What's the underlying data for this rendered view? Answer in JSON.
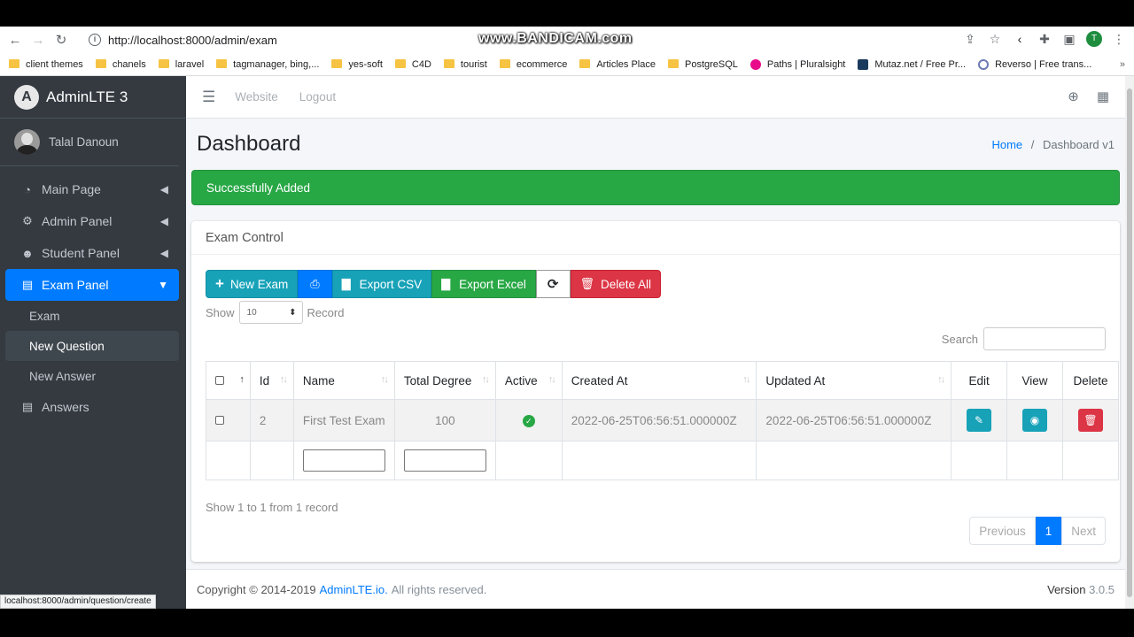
{
  "browser": {
    "url": "http://localhost:8000/admin/exam",
    "watermark": "www.BANDICAM.com",
    "profile_initial": "T",
    "status_url": "localhost:8000/admin/question/create",
    "bookmarks": [
      "client themes",
      "chanels",
      "laravel",
      "tagmanager, bing,...",
      "yes-soft",
      "C4D",
      "tourist",
      "ecommerce",
      "Articles Place",
      "PostgreSQL",
      "Paths | Pluralsight",
      "Mutaz.net / Free Pr...",
      "Reverso | Free trans..."
    ],
    "more": "»"
  },
  "sidebar": {
    "brand": "AdminLTE 3",
    "brand_logo": "A",
    "user": "Talal Danoun",
    "menu": [
      {
        "label": "Main Page",
        "icon": "tachometer-icon"
      },
      {
        "label": "Admin Panel",
        "icon": "users-cog-icon"
      },
      {
        "label": "Student Panel",
        "icon": "users-icon"
      },
      {
        "label": "Exam Panel",
        "icon": "file-icon"
      }
    ],
    "submenu": [
      "Exam",
      "New Question",
      "New Answer"
    ],
    "answers": "Answers"
  },
  "topnav": {
    "website": "Website",
    "logout": "Logout"
  },
  "page": {
    "title": "Dashboard",
    "breadcrumb_home": "Home",
    "breadcrumb_sep": "/",
    "breadcrumb_current": "Dashboard v1",
    "alert": "Successfully Added"
  },
  "card": {
    "title": "Exam Control",
    "buttons": {
      "new_exam": "New Exam",
      "export_csv": "Export CSV",
      "export_excel": "Export Excel",
      "delete_all": "Delete All"
    },
    "show_label": "Show",
    "show_value": "10",
    "record_label": "Record",
    "search_label": "Search",
    "columns": [
      "Id",
      "Name",
      "Total Degree",
      "Active",
      "Created At",
      "Updated At",
      "Edit",
      "View",
      "Delete"
    ],
    "rows": [
      {
        "id": "2",
        "name": "First Test Exam",
        "total": "100",
        "created": "2022-06-25T06:56:51.000000Z",
        "updated": "2022-06-25T06:56:51.000000Z"
      }
    ],
    "info": "Show 1 to 1 from 1 record",
    "pager": {
      "prev": "Previous",
      "current": "1",
      "next": "Next"
    }
  },
  "footer": {
    "copyright": "Copyright © 2014-2019",
    "link": "AdminLTE.io.",
    "rights": "All rights reserved.",
    "version_label": "Version",
    "version": "3.0.5"
  },
  "colors": {
    "primary": "#007bff",
    "success": "#28a745",
    "info": "#17a2b8",
    "danger": "#dc3545",
    "sidebar": "#343a40"
  }
}
